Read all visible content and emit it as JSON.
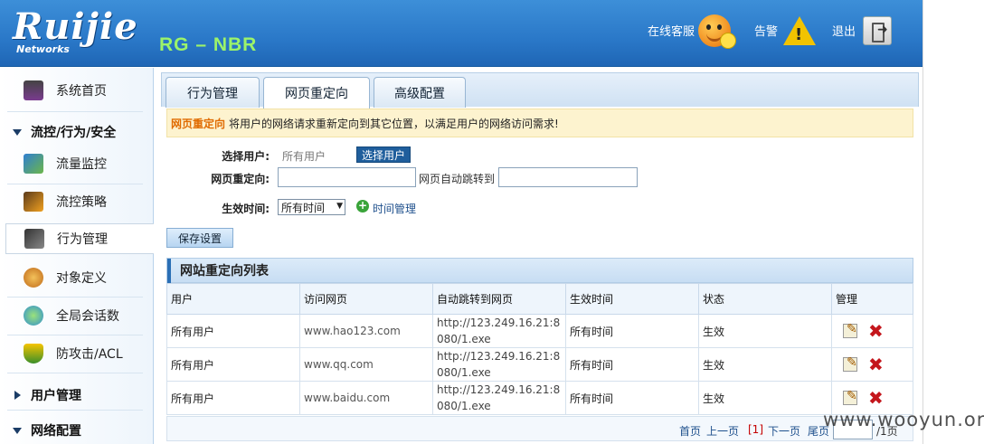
{
  "header": {
    "logo_text": "Ruijie",
    "logo_sub": "Networks",
    "product": "RG – NBR",
    "support_label": "在线客服",
    "alarm_label": "告警",
    "logout_label": "退出"
  },
  "sidebar": {
    "items": [
      {
        "label": "系统首页"
      },
      {
        "label": "流量监控"
      },
      {
        "label": "流控策略"
      },
      {
        "label": "行为管理"
      },
      {
        "label": "对象定义"
      },
      {
        "label": "全局会话数"
      },
      {
        "label": "防攻击/ACL"
      }
    ],
    "groups": [
      {
        "label": "流控/行为/安全"
      },
      {
        "label": "用户管理"
      },
      {
        "label": "网络配置"
      }
    ]
  },
  "tabs": [
    {
      "label": "行为管理"
    },
    {
      "label": "网页重定向"
    },
    {
      "label": "高级配置"
    }
  ],
  "info": {
    "highlight": "网页重定向",
    "text": "将用户的网络请求重新定向到其它位置，以满足用户的网络访问需求!"
  },
  "form": {
    "user_label": "选择用户:",
    "user_value": "所有用户",
    "user_button": "选择用户",
    "redirect_label": "网页重定向:",
    "redirect_value": "",
    "jump_label": "网页自动跳转到",
    "jump_value": "",
    "time_label": "生效时间:",
    "time_value": "所有时间",
    "time_manage": "时间管理",
    "save_button": "保存设置"
  },
  "list": {
    "title": "网站重定向列表",
    "columns": [
      "用户",
      "访问网页",
      "自动跳转到网页",
      "生效时间",
      "状态",
      "管理"
    ],
    "rows": [
      [
        "所有用户",
        "www.hao123.com",
        "http://123.249.16.21:8080/1.exe",
        "所有时间",
        "生效"
      ],
      [
        "所有用户",
        "www.qq.com",
        "http://123.249.16.21:8080/1.exe",
        "所有时间",
        "生效"
      ],
      [
        "所有用户",
        "www.baidu.com",
        "http://123.249.16.21:8080/1.exe",
        "所有时间",
        "生效"
      ]
    ]
  },
  "pager": {
    "first": "首页",
    "prev": "上一页",
    "current": "[1]",
    "next": "下一页",
    "last": "尾页",
    "page_suffix": "/1页"
  },
  "watermark": "www.wooyun.org",
  "colors": {
    "header_blue": "#2a78c8",
    "product_green": "#9cf36a",
    "info_highlight": "#e06b00",
    "delete_red": "#c4161c"
  }
}
